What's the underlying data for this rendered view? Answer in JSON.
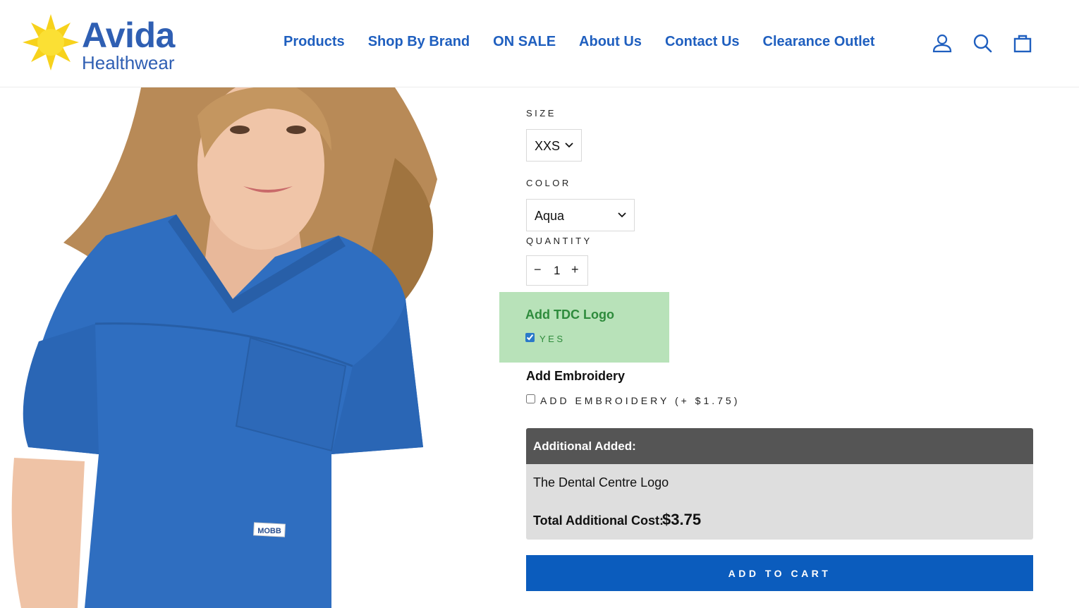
{
  "brand": {
    "name": "Avida",
    "tagline": "Healthwear"
  },
  "nav": [
    {
      "label": "Products"
    },
    {
      "label": "Shop By Brand"
    },
    {
      "label": "ON SALE"
    },
    {
      "label": "About Us"
    },
    {
      "label": "Contact Us"
    },
    {
      "label": "Clearance Outlet"
    }
  ],
  "header_icons": [
    "account-icon",
    "search-icon",
    "cart-bag-icon"
  ],
  "product": {
    "garment_tag": "MOBB",
    "size_label": "SIZE",
    "size_value": "XXS",
    "color_label": "COLOR",
    "color_value": "Aqua",
    "quantity_label": "QUANTITY",
    "quantity_minus": "−",
    "quantity_value": "1",
    "quantity_plus": "+"
  },
  "tdc_logo": {
    "title": "Add TDC Logo",
    "option": "YES",
    "checked": true
  },
  "embroidery": {
    "title": "Add Embroidery",
    "option": "ADD EMBROIDERY (+ $1.75)",
    "checked": false
  },
  "additional": {
    "heading": "Additional Added:",
    "item": "The Dental Centre Logo",
    "total_label": "Total Additional Cost:",
    "total_value": "$3.75"
  },
  "add_to_cart": "ADD TO CART",
  "colors": {
    "brand_blue": "#2f5fb3",
    "nav_blue": "#1f5fbf",
    "scrub_blue": "#2f6ec0",
    "tdc_bg": "#b8e2b9",
    "tdc_text": "#2e8b3c",
    "summary_head": "#555555",
    "summary_body": "#dedede",
    "cart_button": "#0b5cbd"
  }
}
